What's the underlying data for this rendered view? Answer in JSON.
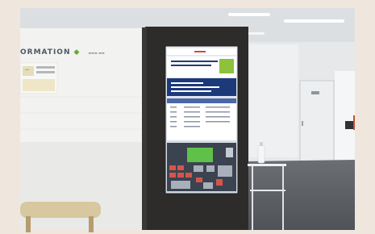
{
  "wall_sign": {
    "text": "ORMATION",
    "diamond": "◆",
    "tiny": "▬▬▬ ▬▬"
  },
  "kiosk": {
    "header_brand": "▬▬ ▬▬▬",
    "banner_title": "▬▬▬▬▬▬▬▬▬▬▬",
    "message_line_1": "▬▬▬▬▬▬▬▬",
    "message_line_2": "▬▬▬▬▬▬▬▬▬▬▬",
    "list_header": "▬ ▬▬ ▬▬▬▬▬▬▬▬▬ ▬▬"
  },
  "door_sign": "▬▬"
}
